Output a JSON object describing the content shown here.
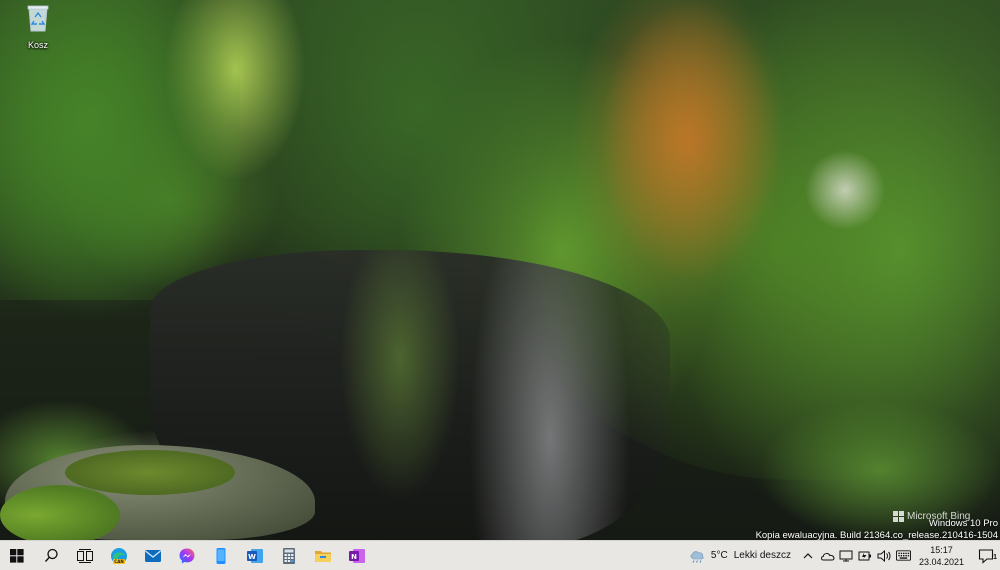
{
  "desktop": {
    "icons": [
      {
        "label": "Kosz",
        "icon": "recycle-bin-icon"
      }
    ]
  },
  "watermark": {
    "brand": "Microsoft Bing",
    "edition": "Windows 10 Pro",
    "build": "Kopia ewaluacyjna. Build 21364.co_release.210416-1504"
  },
  "taskbar": {
    "start": "windows-logo-icon",
    "search": "search-icon",
    "taskview": "task-view-icon",
    "apps": [
      {
        "name": "Microsoft Edge Canary",
        "icon": "edge-canary-icon",
        "color": "#1b9de2"
      },
      {
        "name": "Mail",
        "icon": "mail-icon",
        "color": "#0f6cbd"
      },
      {
        "name": "Messenger",
        "icon": "messenger-icon",
        "color": "#a334fa"
      },
      {
        "name": "Phone",
        "icon": "phone-icon",
        "color": "#1e90ff"
      },
      {
        "name": "Word",
        "icon": "word-icon",
        "color": "#2b579a"
      },
      {
        "name": "Calculator",
        "icon": "calculator-icon",
        "color": "#5f6b7a"
      },
      {
        "name": "File Explorer",
        "icon": "file-explorer-icon",
        "color": "#f2c24b"
      },
      {
        "name": "OneNote",
        "icon": "onenote-icon",
        "color": "#7719aa"
      }
    ],
    "weather": {
      "temp": "5°C",
      "condition": "Lekki deszcz"
    },
    "tray_icons": [
      "chevron-up-icon",
      "onedrive-icon",
      "network-icon",
      "battery-icon",
      "volume-icon",
      "keyboard-icon"
    ],
    "clock": {
      "time": "15:17",
      "date": "23.04.2021"
    },
    "notifications": {
      "count": "1"
    }
  }
}
